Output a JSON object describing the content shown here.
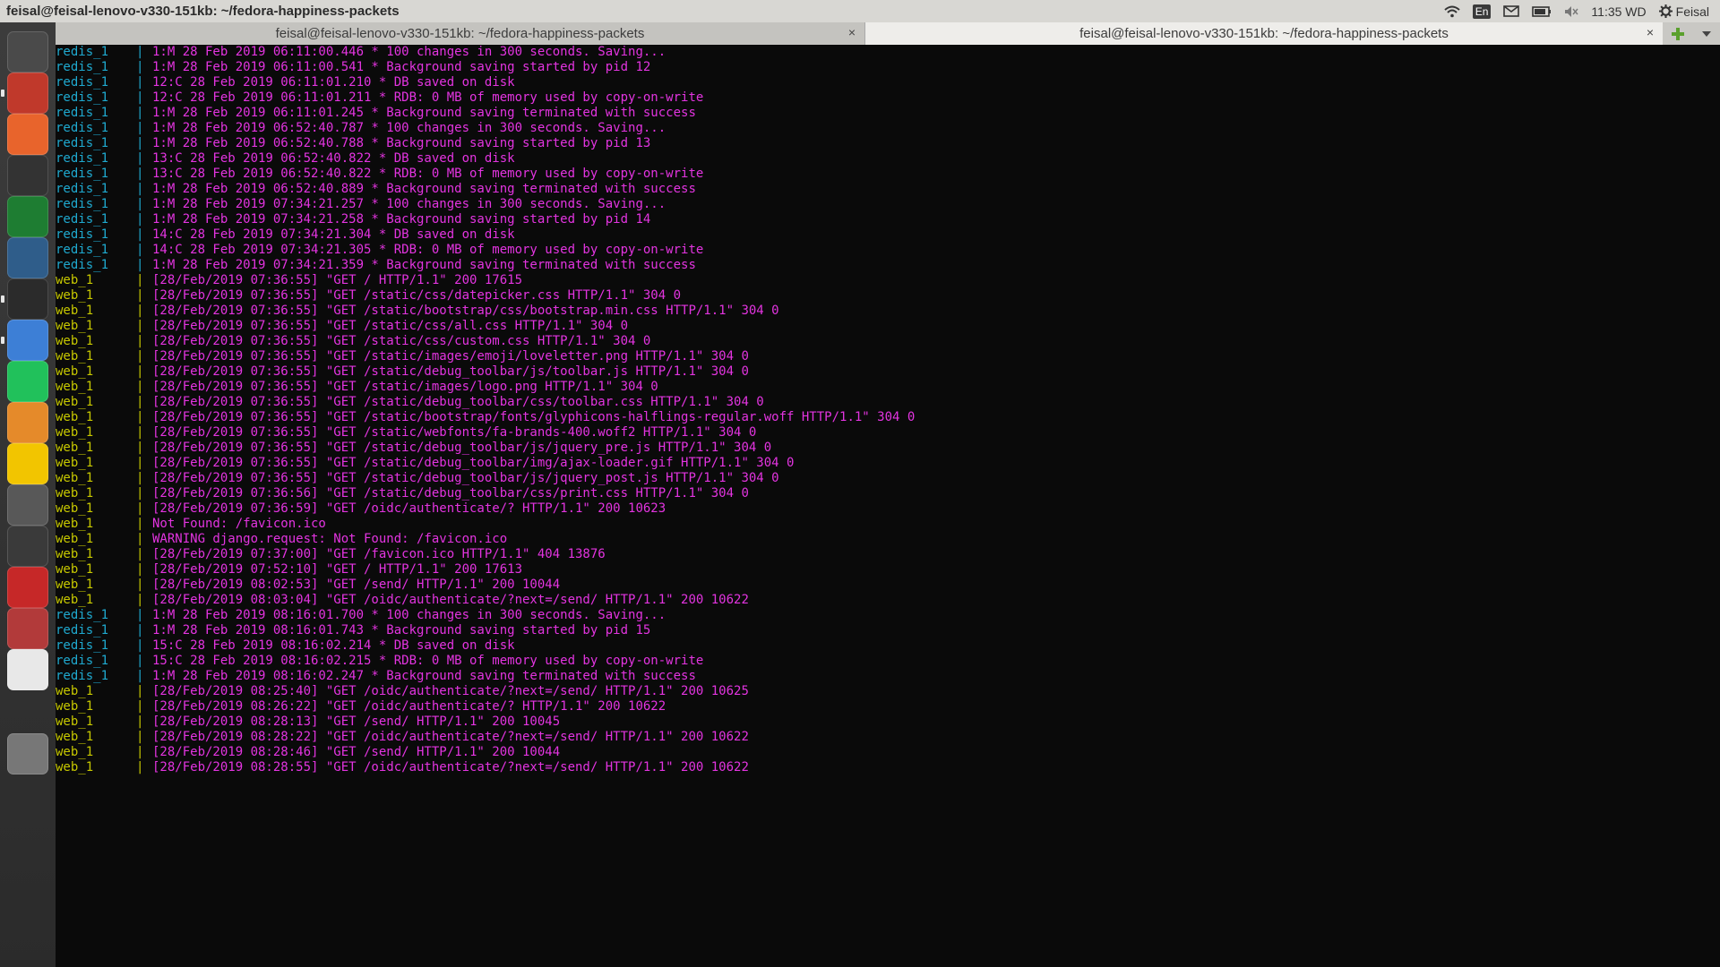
{
  "panel": {
    "title": "feisal@feisal-lenovo-v330-151kb: ~/fedora-happiness-packets",
    "keyboard": "En",
    "clock": "11:35 WD",
    "user": "Feisal"
  },
  "launcher": {
    "items": [
      {
        "name": "system-settings-icon",
        "color": "#4a4a4a"
      },
      {
        "name": "file-cabinet-icon",
        "color": "#c0392b"
      },
      {
        "name": "software-center-icon",
        "color": "#e8642c"
      },
      {
        "name": "video-editor-icon",
        "color": "#333333"
      },
      {
        "name": "vim-icon",
        "color": "#1e7d32"
      },
      {
        "name": "postgres-elephant-icon",
        "color": "#2f5d8a"
      },
      {
        "name": "terminal-icon",
        "color": "#2b2b2b"
      },
      {
        "name": "chrome-icon",
        "color": "#3d7fd6"
      },
      {
        "name": "pycharm-icon",
        "color": "#21c15b"
      },
      {
        "name": "sublime-text-icon",
        "color": "#e58a2a"
      },
      {
        "name": "2do-icon",
        "color": "#f2c500"
      },
      {
        "name": "gimp-icon",
        "color": "#585858"
      },
      {
        "name": "software-updater-icon",
        "color": "#3a3a3a"
      },
      {
        "name": "text-editor-icon",
        "color": "#c62828"
      },
      {
        "name": "settings-tools-icon",
        "color": "#b23a3a"
      },
      {
        "name": "amazon-icon",
        "color": "#e8e8e8"
      },
      {
        "name": "trash-icon",
        "color": "#777777"
      }
    ]
  },
  "tabs": [
    {
      "label": "feisal@feisal-lenovo-v330-151kb: ~/fedora-happiness-packets",
      "close": "×"
    },
    {
      "label": "feisal@feisal-lenovo-v330-151kb: ~/fedora-happiness-packets",
      "close": "×"
    }
  ],
  "log": [
    {
      "svc": "redis_1",
      "msg": "1:M 28 Feb 2019 06:11:00.446 * 100 changes in 300 seconds. Saving..."
    },
    {
      "svc": "redis_1",
      "msg": "1:M 28 Feb 2019 06:11:00.541 * Background saving started by pid 12"
    },
    {
      "svc": "redis_1",
      "msg": "12:C 28 Feb 2019 06:11:01.210 * DB saved on disk"
    },
    {
      "svc": "redis_1",
      "msg": "12:C 28 Feb 2019 06:11:01.211 * RDB: 0 MB of memory used by copy-on-write"
    },
    {
      "svc": "redis_1",
      "msg": "1:M 28 Feb 2019 06:11:01.245 * Background saving terminated with success"
    },
    {
      "svc": "redis_1",
      "msg": "1:M 28 Feb 2019 06:52:40.787 * 100 changes in 300 seconds. Saving..."
    },
    {
      "svc": "redis_1",
      "msg": "1:M 28 Feb 2019 06:52:40.788 * Background saving started by pid 13"
    },
    {
      "svc": "redis_1",
      "msg": "13:C 28 Feb 2019 06:52:40.822 * DB saved on disk"
    },
    {
      "svc": "redis_1",
      "msg": "13:C 28 Feb 2019 06:52:40.822 * RDB: 0 MB of memory used by copy-on-write"
    },
    {
      "svc": "redis_1",
      "msg": "1:M 28 Feb 2019 06:52:40.889 * Background saving terminated with success"
    },
    {
      "svc": "redis_1",
      "msg": "1:M 28 Feb 2019 07:34:21.257 * 100 changes in 300 seconds. Saving..."
    },
    {
      "svc": "redis_1",
      "msg": "1:M 28 Feb 2019 07:34:21.258 * Background saving started by pid 14"
    },
    {
      "svc": "redis_1",
      "msg": "14:C 28 Feb 2019 07:34:21.304 * DB saved on disk"
    },
    {
      "svc": "redis_1",
      "msg": "14:C 28 Feb 2019 07:34:21.305 * RDB: 0 MB of memory used by copy-on-write"
    },
    {
      "svc": "redis_1",
      "msg": "1:M 28 Feb 2019 07:34:21.359 * Background saving terminated with success"
    },
    {
      "svc": "web_1",
      "msg": "[28/Feb/2019 07:36:55] \"GET / HTTP/1.1\" 200 17615"
    },
    {
      "svc": "web_1",
      "msg": "[28/Feb/2019 07:36:55] \"GET /static/css/datepicker.css HTTP/1.1\" 304 0"
    },
    {
      "svc": "web_1",
      "msg": "[28/Feb/2019 07:36:55] \"GET /static/bootstrap/css/bootstrap.min.css HTTP/1.1\" 304 0"
    },
    {
      "svc": "web_1",
      "msg": "[28/Feb/2019 07:36:55] \"GET /static/css/all.css HTTP/1.1\" 304 0"
    },
    {
      "svc": "web_1",
      "msg": "[28/Feb/2019 07:36:55] \"GET /static/css/custom.css HTTP/1.1\" 304 0"
    },
    {
      "svc": "web_1",
      "msg": "[28/Feb/2019 07:36:55] \"GET /static/images/emoji/loveletter.png HTTP/1.1\" 304 0"
    },
    {
      "svc": "web_1",
      "msg": "[28/Feb/2019 07:36:55] \"GET /static/debug_toolbar/js/toolbar.js HTTP/1.1\" 304 0"
    },
    {
      "svc": "web_1",
      "msg": "[28/Feb/2019 07:36:55] \"GET /static/images/logo.png HTTP/1.1\" 304 0"
    },
    {
      "svc": "web_1",
      "msg": "[28/Feb/2019 07:36:55] \"GET /static/debug_toolbar/css/toolbar.css HTTP/1.1\" 304 0"
    },
    {
      "svc": "web_1",
      "msg": "[28/Feb/2019 07:36:55] \"GET /static/bootstrap/fonts/glyphicons-halflings-regular.woff HTTP/1.1\" 304 0"
    },
    {
      "svc": "web_1",
      "msg": "[28/Feb/2019 07:36:55] \"GET /static/webfonts/fa-brands-400.woff2 HTTP/1.1\" 304 0"
    },
    {
      "svc": "web_1",
      "msg": "[28/Feb/2019 07:36:55] \"GET /static/debug_toolbar/js/jquery_pre.js HTTP/1.1\" 304 0"
    },
    {
      "svc": "web_1",
      "msg": "[28/Feb/2019 07:36:55] \"GET /static/debug_toolbar/img/ajax-loader.gif HTTP/1.1\" 304 0"
    },
    {
      "svc": "web_1",
      "msg": "[28/Feb/2019 07:36:55] \"GET /static/debug_toolbar/js/jquery_post.js HTTP/1.1\" 304 0"
    },
    {
      "svc": "web_1",
      "msg": "[28/Feb/2019 07:36:56] \"GET /static/debug_toolbar/css/print.css HTTP/1.1\" 304 0"
    },
    {
      "svc": "web_1",
      "msg": "[28/Feb/2019 07:36:59] \"GET /oidc/authenticate/? HTTP/1.1\" 200 10623"
    },
    {
      "svc": "web_1",
      "msg": "Not Found: /favicon.ico"
    },
    {
      "svc": "web_1",
      "msg": "WARNING django.request: Not Found: /favicon.ico"
    },
    {
      "svc": "web_1",
      "msg": "[28/Feb/2019 07:37:00] \"GET /favicon.ico HTTP/1.1\" 404 13876"
    },
    {
      "svc": "web_1",
      "msg": "[28/Feb/2019 07:52:10] \"GET / HTTP/1.1\" 200 17613"
    },
    {
      "svc": "web_1",
      "msg": "[28/Feb/2019 08:02:53] \"GET /send/ HTTP/1.1\" 200 10044"
    },
    {
      "svc": "web_1",
      "msg": "[28/Feb/2019 08:03:04] \"GET /oidc/authenticate/?next=/send/ HTTP/1.1\" 200 10622"
    },
    {
      "svc": "redis_1",
      "msg": "1:M 28 Feb 2019 08:16:01.700 * 100 changes in 300 seconds. Saving..."
    },
    {
      "svc": "redis_1",
      "msg": "1:M 28 Feb 2019 08:16:01.743 * Background saving started by pid 15"
    },
    {
      "svc": "redis_1",
      "msg": "15:C 28 Feb 2019 08:16:02.214 * DB saved on disk"
    },
    {
      "svc": "redis_1",
      "msg": "15:C 28 Feb 2019 08:16:02.215 * RDB: 0 MB of memory used by copy-on-write"
    },
    {
      "svc": "redis_1",
      "msg": "1:M 28 Feb 2019 08:16:02.247 * Background saving terminated with success"
    },
    {
      "svc": "web_1",
      "msg": "[28/Feb/2019 08:25:40] \"GET /oidc/authenticate/?next=/send/ HTTP/1.1\" 200 10625"
    },
    {
      "svc": "web_1",
      "msg": "[28/Feb/2019 08:26:22] \"GET /oidc/authenticate/? HTTP/1.1\" 200 10622"
    },
    {
      "svc": "web_1",
      "msg": "[28/Feb/2019 08:28:13] \"GET /send/ HTTP/1.1\" 200 10045"
    },
    {
      "svc": "web_1",
      "msg": "[28/Feb/2019 08:28:22] \"GET /oidc/authenticate/?next=/send/ HTTP/1.1\" 200 10622"
    },
    {
      "svc": "web_1",
      "msg": "[28/Feb/2019 08:28:46] \"GET /send/ HTTP/1.1\" 200 10044"
    },
    {
      "svc": "web_1",
      "msg": "[28/Feb/2019 08:28:55] \"GET /oidc/authenticate/?next=/send/ HTTP/1.1\" 200 10622"
    }
  ],
  "colors": {
    "redis": "#1fa9cf",
    "web": "#c7c800",
    "message": "#e334e0"
  }
}
